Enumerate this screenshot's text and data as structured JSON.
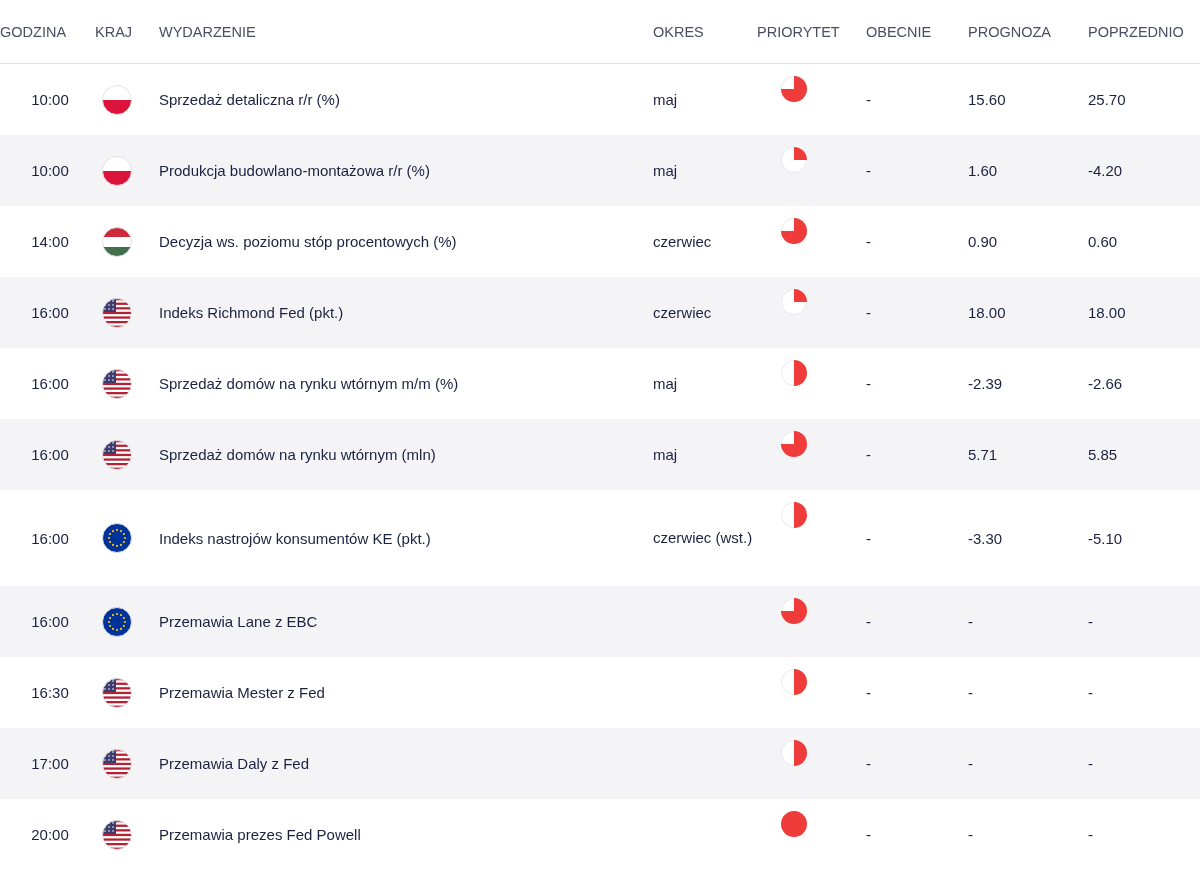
{
  "columns": [
    "GODZINA",
    "KRAJ",
    "WYDARZENIE",
    "OKRES",
    "PRIORYTET",
    "OBECNIE",
    "PROGNOZA",
    "POPRZEDNIO"
  ],
  "rows": [
    {
      "time": "10:00",
      "kind": "pl",
      "event": "Sprzedaż detaliczna r/r (%)",
      "period": "maj",
      "priority": {
        "kind": "three-quarter"
      },
      "current": "-",
      "forecast": "15.60",
      "previous": "25.70"
    },
    {
      "time": "10:00",
      "kind": "pl",
      "event": "Produkcja budowlano-montażowa r/r (%)",
      "period": "maj",
      "priority": {
        "kind": "quarter"
      },
      "current": "-",
      "forecast": "1.60",
      "previous": "-4.20"
    },
    {
      "time": "14:00",
      "kind": "hu",
      "event": "Decyzja ws. poziomu stóp procentowych (%)",
      "period": "czerwiec",
      "priority": {
        "kind": "three-quarter"
      },
      "current": "-",
      "forecast": "0.90",
      "previous": "0.60"
    },
    {
      "time": "16:00",
      "kind": "us",
      "event": "Indeks Richmond Fed (pkt.)",
      "period": "czerwiec",
      "priority": {
        "kind": "quarter"
      },
      "current": "-",
      "forecast": "18.00",
      "previous": "18.00"
    },
    {
      "time": "16:00",
      "kind": "us",
      "event": "Sprzedaż domów na rynku wtórnym m/m (%)",
      "period": "maj",
      "priority": {
        "kind": "half"
      },
      "current": "-",
      "forecast": "-2.39",
      "previous": "-2.66"
    },
    {
      "time": "16:00",
      "kind": "us",
      "event": "Sprzedaż domów na rynku wtórnym (mln)",
      "period": "maj",
      "priority": {
        "kind": "three-quarter"
      },
      "current": "-",
      "forecast": "5.71",
      "previous": "5.85"
    },
    {
      "time": "16:00",
      "kind": "eu",
      "event": "Indeks nastrojów konsumentów KE (pkt.)",
      "period": "czerwiec (wst.)",
      "priority": {
        "kind": "half"
      },
      "current": "-",
      "forecast": "-3.30",
      "previous": "-5.10"
    },
    {
      "time": "16:00",
      "kind": "eu",
      "event": "Przemawia Lane z EBC",
      "priority": {
        "kind": "three-quarter"
      },
      "current": "-",
      "forecast": "-",
      "previous": "-"
    },
    {
      "time": "16:30",
      "kind": "us",
      "event": "Przemawia Mester z Fed",
      "priority": {
        "kind": "half"
      },
      "current": "-",
      "forecast": "-",
      "previous": "-"
    },
    {
      "time": "17:00",
      "kind": "us",
      "event": "Przemawia Daly z Fed",
      "priority": {
        "kind": "half"
      },
      "current": "-",
      "forecast": "-",
      "previous": "-"
    },
    {
      "time": "20:00",
      "kind": "us",
      "event": "Przemawia prezes Fed Powell",
      "priority": {
        "kind": "full"
      },
      "current": "-",
      "forecast": "-",
      "previous": "-"
    }
  ]
}
